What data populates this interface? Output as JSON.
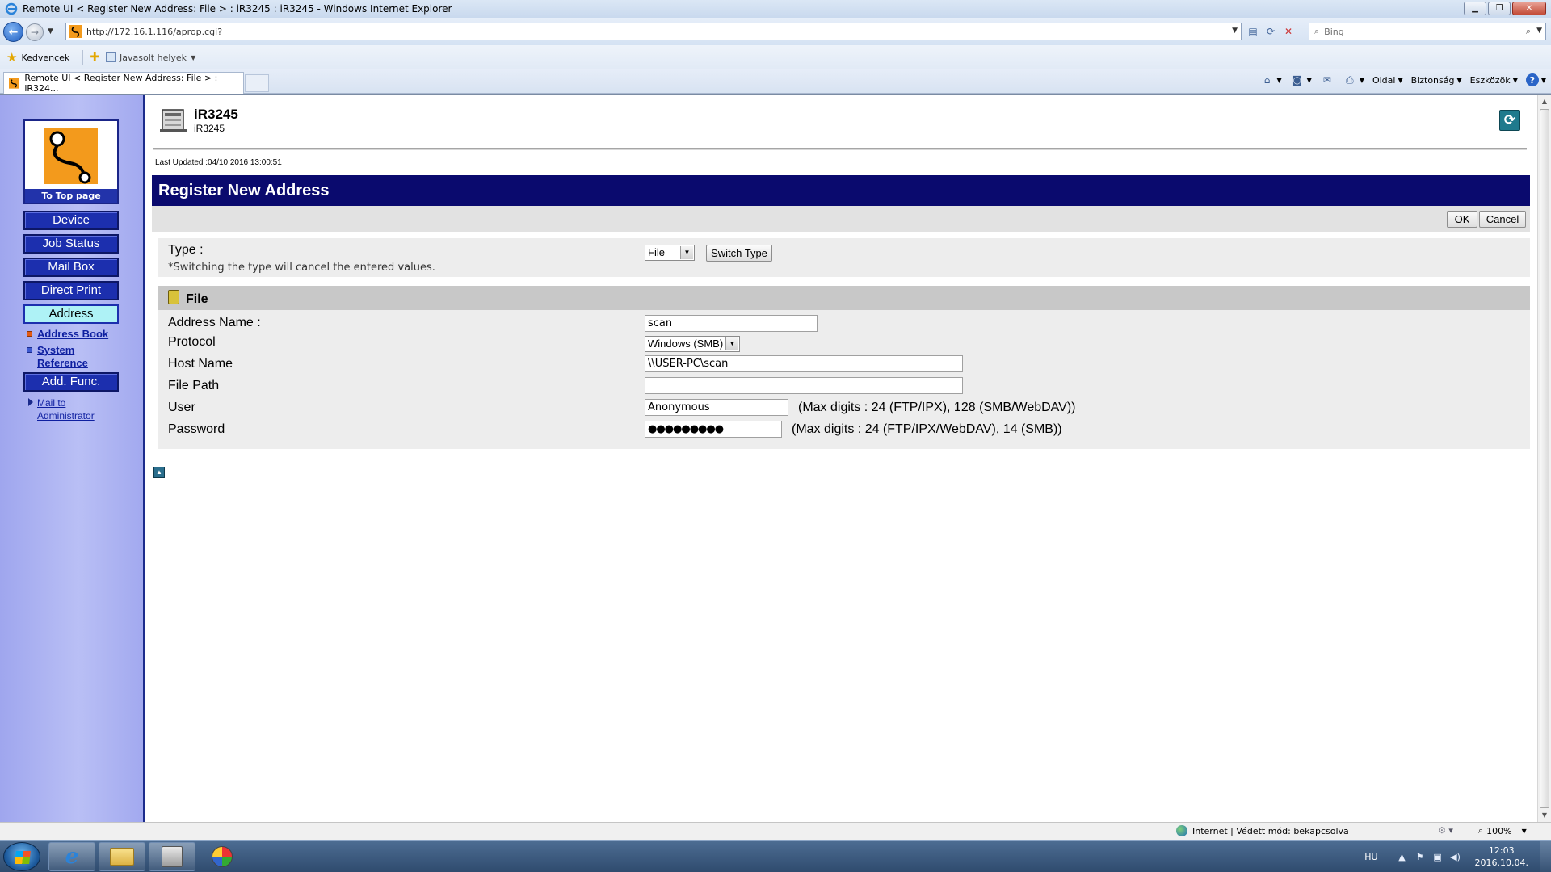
{
  "window": {
    "title": "Remote UI < Register New Address: File > : iR3245 : iR3245 - Windows Internet Explorer"
  },
  "addressbar": {
    "url_host": "http://172.16.1.116",
    "url_path": "/aprop.cgi?",
    "search_placeholder": "Bing"
  },
  "favorites": {
    "favorites_label": "Kedvencek",
    "suggested_label": "Javasolt helyek"
  },
  "tab": {
    "title": "Remote UI < Register New Address: File > : iR324..."
  },
  "commandbar": {
    "page": "Oldal",
    "safety": "Biztonság",
    "tools": "Eszközök"
  },
  "sidebar": {
    "top_page": "To Top page",
    "nav": [
      "Device",
      "Job Status",
      "Mail Box",
      "Direct Print",
      "Address",
      "Add. Func."
    ],
    "active_index": 4,
    "sublinks": {
      "address_book": "Address Book",
      "system_reference_1": "System",
      "system_reference_2": "Reference",
      "mail_admin_1": "Mail to",
      "mail_admin_2": "Administrator"
    }
  },
  "header": {
    "device_name": "iR3245",
    "device_sub": "iR3245",
    "last_updated": "Last Updated :04/10 2016 13:00:51"
  },
  "page": {
    "title": "Register New Address",
    "ok": "OK",
    "cancel": "Cancel"
  },
  "type_section": {
    "label": "Type :",
    "note": "*Switching the type will cancel the entered values.",
    "selected": "File",
    "switch_button": "Switch Type"
  },
  "file_section": {
    "title": "File",
    "address_name_label": "Address Name :",
    "address_name_value": "scan",
    "protocol_label": "Protocol",
    "protocol_value": "Windows (SMB)",
    "host_label": "Host Name",
    "host_value": "\\\\USER-PC\\scan",
    "file_path_label": "File Path",
    "file_path_value": "",
    "user_label": "User",
    "user_value": "Anonymous",
    "user_hint": "(Max digits : 24 (FTP/IPX), 128 (SMB/WebDAV))",
    "password_label": "Password",
    "password_value": "●●●●●●●●●",
    "password_hint": "(Max digits : 24 (FTP/IPX/WebDAV), 14 (SMB))"
  },
  "statusbar": {
    "zone": "Internet | Védett mód: bekapcsolva",
    "zoom": "100%"
  },
  "taskbar": {
    "lang": "HU",
    "time": "12:03",
    "date": "2016.10.04."
  }
}
